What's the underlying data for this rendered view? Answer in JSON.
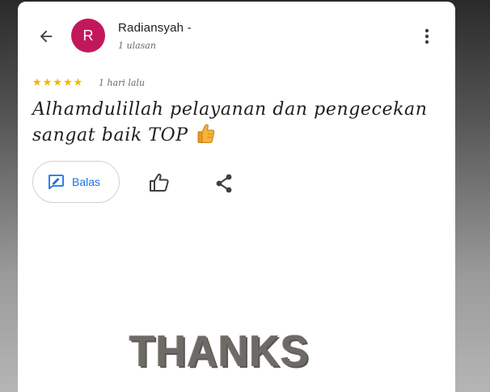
{
  "review": {
    "reviewer_name": "Radiansyah -",
    "avatar_initial": "R",
    "review_count": "1 ulasan",
    "rating": 5,
    "stars": [
      "★",
      "★",
      "★",
      "★",
      "★"
    ],
    "time_ago": "1 hari lalu",
    "text": "Alhamdulillah pelayanan dan pengecekan sangat baik TOP",
    "emoji_icon": "thumbs-up-emoji"
  },
  "actions": {
    "reply_label": "Balas",
    "reply_icon": "reply-icon",
    "like_icon": "thumbs-up-icon",
    "share_icon": "share-icon",
    "back_icon": "arrow-left-icon",
    "more_icon": "more-vert-icon"
  },
  "overlay": {
    "thanks_text": "THANKS"
  },
  "colors": {
    "avatar_bg": "#c2185b",
    "star": "#f5b400",
    "link": "#1a73e8"
  }
}
